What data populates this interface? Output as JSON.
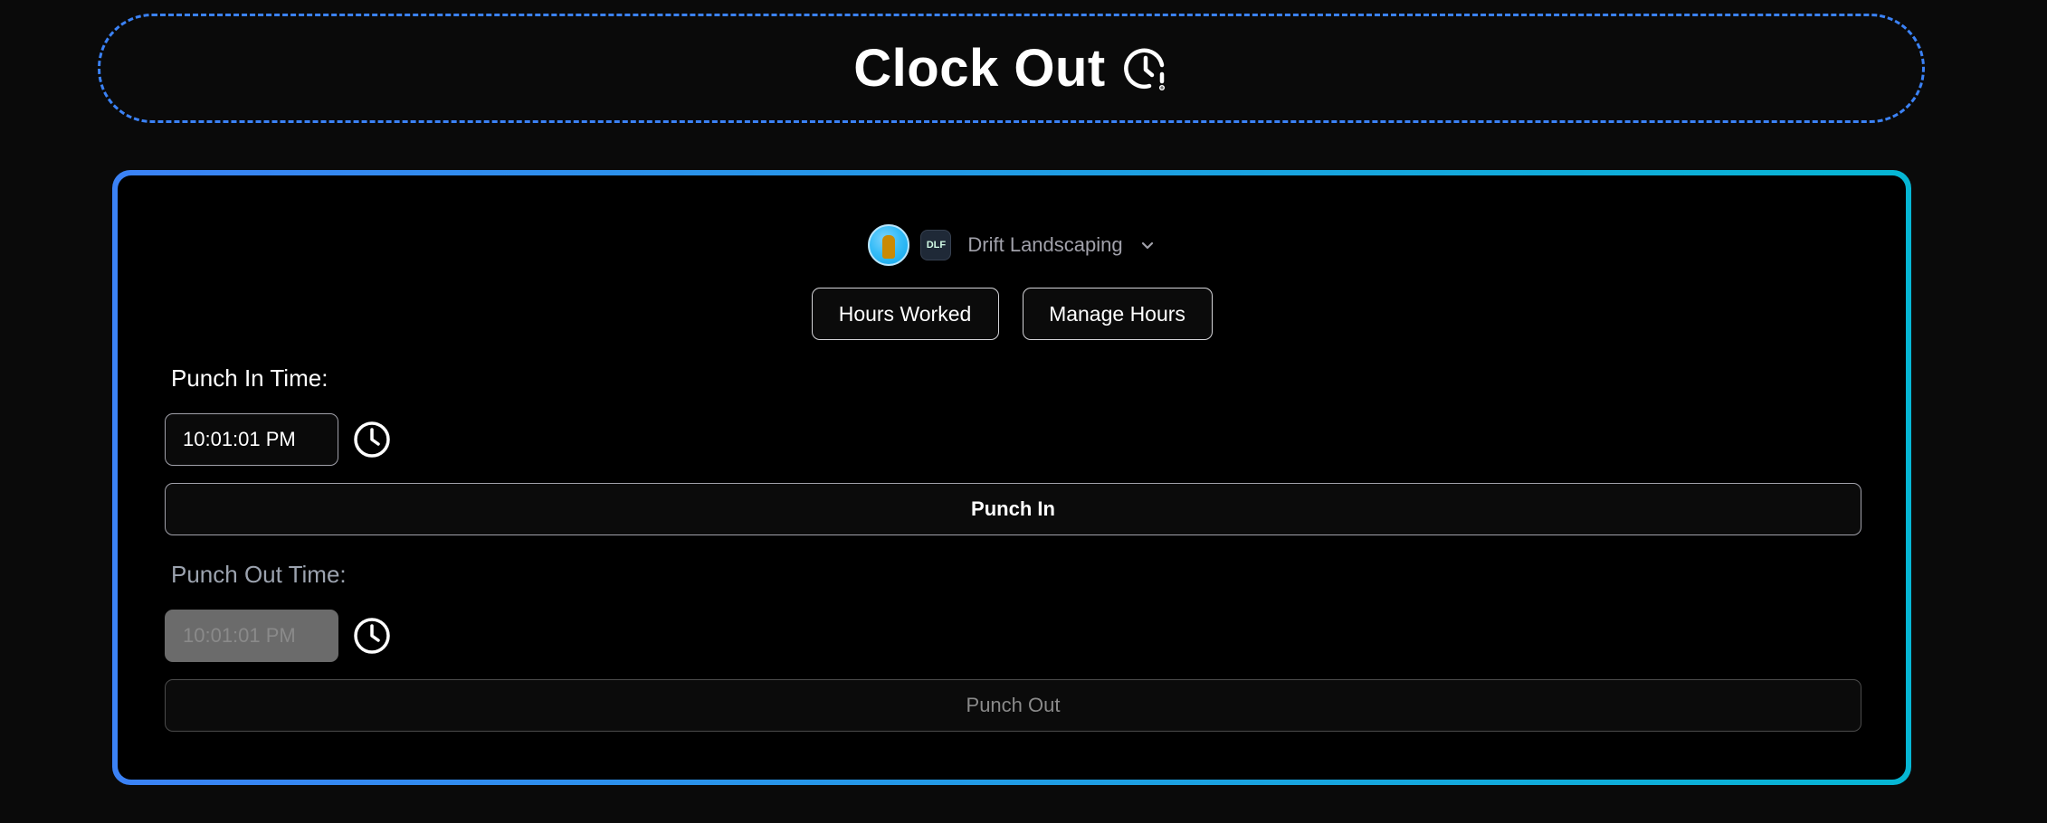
{
  "header": {
    "title": "Clock Out",
    "icon": "clock-alert-icon"
  },
  "business": {
    "name": "Drift Landscaping",
    "logo_text": "DLF",
    "avatar_icon": "user-avatar",
    "dropdown_icon": "chevron-down-icon"
  },
  "actions": {
    "hours_worked_label": "Hours Worked",
    "manage_hours_label": "Manage Hours"
  },
  "punch_in": {
    "label": "Punch In Time:",
    "time_value": "10:01:01 PM",
    "button_label": "Punch In",
    "icon": "clock-icon"
  },
  "punch_out": {
    "label": "Punch Out Time:",
    "time_value": "10:01:01 PM",
    "button_label": "Punch Out",
    "icon": "clock-icon",
    "disabled": true
  },
  "colors": {
    "background": "#0a0a0a",
    "accent_blue": "#3b82f6",
    "accent_cyan": "#06b6d4"
  }
}
